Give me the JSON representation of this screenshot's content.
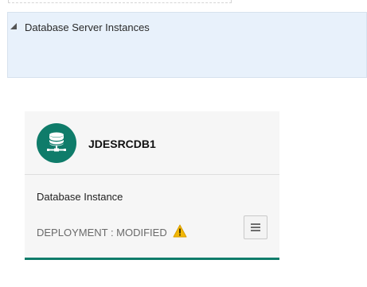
{
  "section": {
    "title": "Database Server Instances",
    "expanded": true
  },
  "card": {
    "instance_name": "JDESRCDB1",
    "instance_type": "Database Instance",
    "deployment_status": "DEPLOYMENT : MODIFIED",
    "status_icon": "warning-icon",
    "type_icon": "database-server-icon",
    "menu_icon": "hamburger-menu-icon"
  },
  "colors": {
    "accent": "#0f7c6a",
    "header_background": "#e8f1fb",
    "warning": "#f2b705",
    "card_background": "#f6f6f6"
  }
}
